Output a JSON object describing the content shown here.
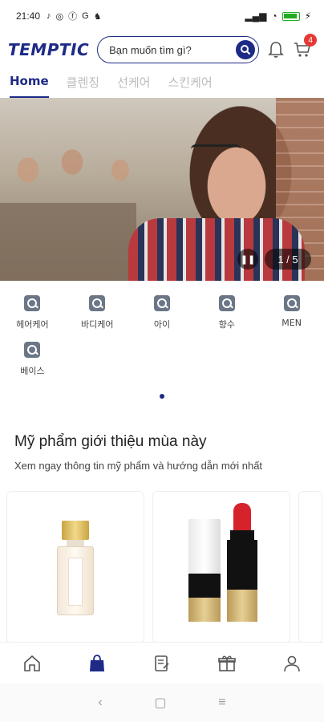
{
  "status_bar": {
    "time": "21:40",
    "notif_icons": [
      "tiktok-icon",
      "messenger-icon",
      "facebook-icon",
      "google-icon",
      "app-icon"
    ],
    "right_icons": [
      "signal-icon",
      "wifi-icon",
      "battery-icon",
      "charging-icon"
    ]
  },
  "header": {
    "logo": "TEMPTIC",
    "search_placeholder": "Bạn muốn tìm gì?",
    "cart_badge": "4",
    "brand_color": "#1d2a86"
  },
  "tabs": [
    {
      "label": "Home",
      "active": true
    },
    {
      "label": "클렌징",
      "active": false
    },
    {
      "label": "선케어",
      "active": false
    },
    {
      "label": "스킨케어",
      "active": false
    }
  ],
  "banner": {
    "counter": "1 / 5",
    "pause_symbol": "❚❚"
  },
  "categories": [
    {
      "label": "헤어케어",
      "icon": "search-icon"
    },
    {
      "label": "바디케어",
      "icon": "search-icon"
    },
    {
      "label": "아이",
      "icon": "search-icon"
    },
    {
      "label": "향수",
      "icon": "search-icon"
    },
    {
      "label": "MEN",
      "icon": "search-icon"
    },
    {
      "label": "베이스",
      "icon": "search-icon"
    }
  ],
  "section": {
    "title": "Mỹ phẩm giới thiệu mùa này",
    "subtitle": "Xem ngay thông tin mỹ phẩm và hướng dẫn mới nhất"
  },
  "bottom_nav": [
    "home-icon",
    "shopping-bag-icon",
    "notes-icon",
    "gift-icon",
    "profile-icon"
  ],
  "system_nav": {
    "back": "‹",
    "home": "▢",
    "menu": "≡"
  }
}
